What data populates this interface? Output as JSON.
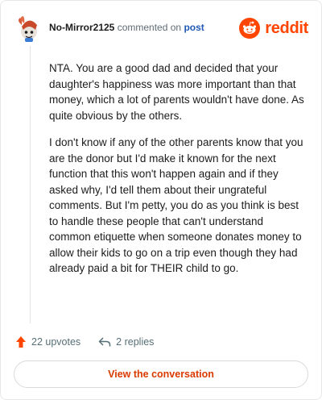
{
  "header": {
    "username": "No-Mirror2125",
    "action_text": "commented on",
    "post_link": "post",
    "brand": "reddit",
    "brand_color": "#ff4500",
    "avatar_icon": "snoo-avatar-icon"
  },
  "comment": {
    "paragraphs": [
      "NTA. You are a good dad and decided that your daughter's happiness was more important than that money, which a lot of parents wouldn't have done. As quite obvious by the others.",
      "I don't know if any of the other parents know that you are the donor but I'd make it known for the next function that this won't happen again and if they asked why, I'd tell them about their ungrateful comments. But I'm petty, you do as you think is best to handle these people that can't understand common etiquette when someone donates money to allow their kids to go on a trip even though they had already paid a bit for THEIR child to go."
    ]
  },
  "actions": {
    "upvotes": "22 upvotes",
    "replies": "2 replies",
    "upvote_icon": "upvote-arrow-icon",
    "reply_icon": "reply-arrow-icon",
    "upvote_color": "#ff4500"
  },
  "cta": {
    "label": "View the conversation",
    "color": "#d93a00"
  }
}
